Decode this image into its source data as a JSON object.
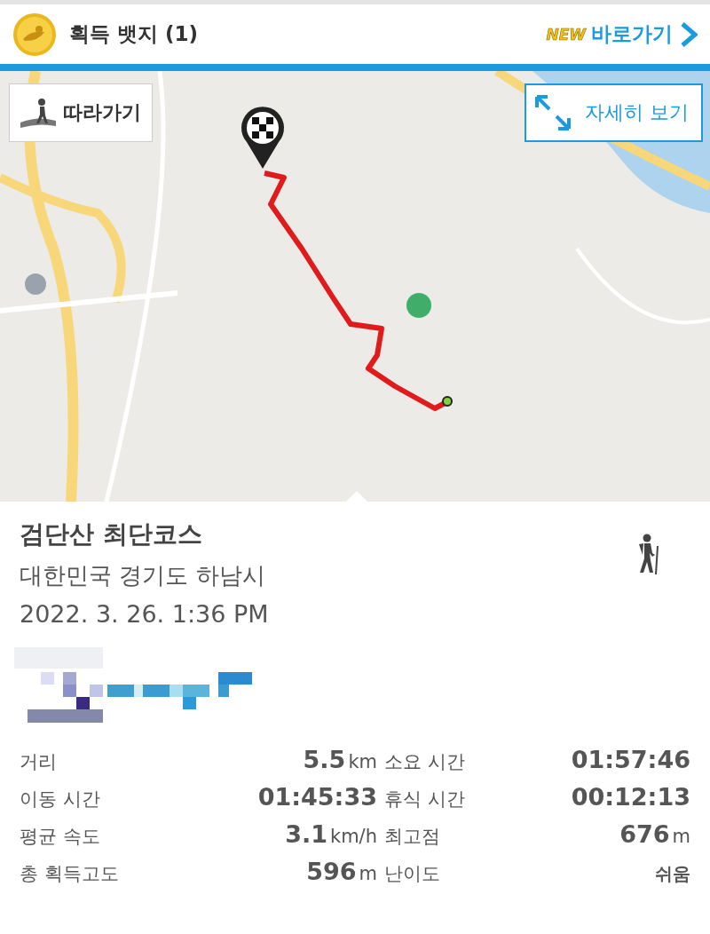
{
  "header": {
    "title": "획득 뱃지 (1)",
    "new_badge": "NEW",
    "shortcut": "바로가기"
  },
  "map": {
    "kind": "picture",
    "follow_button": "따라가기",
    "detail_button": "자세히 보기"
  },
  "course": {
    "title": "검단산 최단코스",
    "location": "대한민국 경기도 하남시",
    "date": "2022. 3. 26. 1:36 PM"
  },
  "stats": [
    {
      "kind": "measure",
      "label": "거리",
      "value": "5.5",
      "unit": "km"
    },
    {
      "kind": "measure",
      "label": "소요 시간",
      "value": "01:57:46"
    },
    {
      "kind": "measure",
      "label": "이동 시간",
      "value": "01:45:33"
    },
    {
      "kind": "measure",
      "label": "휴식 시간",
      "value": "00:12:13"
    },
    {
      "kind": "measure",
      "label": "평균 속도",
      "value": "3.1",
      "unit": "km/h"
    },
    {
      "kind": "measure",
      "label": "최고점",
      "value": "676",
      "unit": "m"
    },
    {
      "kind": "measure",
      "label": "총 획득고도",
      "value": "596",
      "unit": "m"
    },
    {
      "kind": "grade",
      "label": "난이도",
      "value": "쉬움"
    }
  ]
}
